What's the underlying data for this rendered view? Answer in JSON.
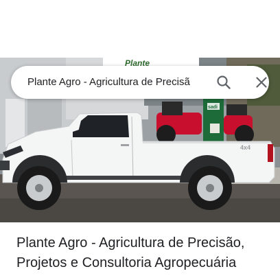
{
  "search": {
    "query": "Plante Agro - Agricultura de Precisã",
    "search_icon": "search-icon",
    "close_icon": "close-icon"
  },
  "photo": {
    "sign_text": "Plante",
    "tank_text": "sadi",
    "truck_badge": "4x4"
  },
  "result": {
    "title": "Plante Agro - Agricultura de Precisão, Projetos e Consultoria Agropecuária"
  },
  "colors": {
    "text_primary": "#202124",
    "icon_gray": "#5f6368",
    "quad_red": "#c8102e",
    "tank_green": "#1e6b3a"
  }
}
